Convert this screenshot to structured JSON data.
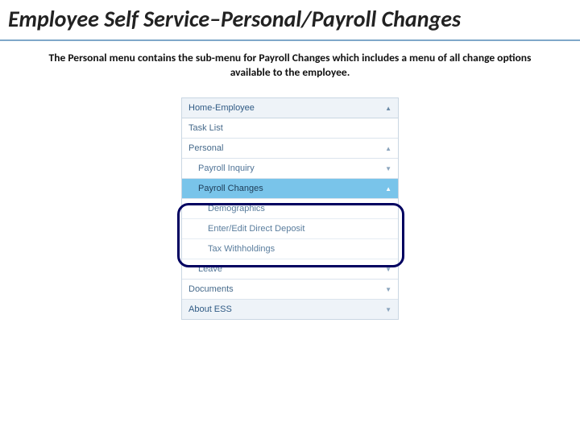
{
  "title": "Employee Self Service–Personal/Payroll Changes",
  "subtitle": "The Personal menu contains the sub-menu for Payroll Changes which includes a menu of all change options available to the employee.",
  "menu": {
    "home": "Home-Employee",
    "task_list": "Task List",
    "personal": "Personal",
    "payroll_inquiry": "Payroll Inquiry",
    "payroll_changes": "Payroll Changes",
    "demographics": "Demographics",
    "direct_deposit": "Enter/Edit Direct Deposit",
    "tax_withholdings": "Tax Withholdings",
    "leave": "Leave",
    "documents": "Documents",
    "about": "About ESS"
  }
}
